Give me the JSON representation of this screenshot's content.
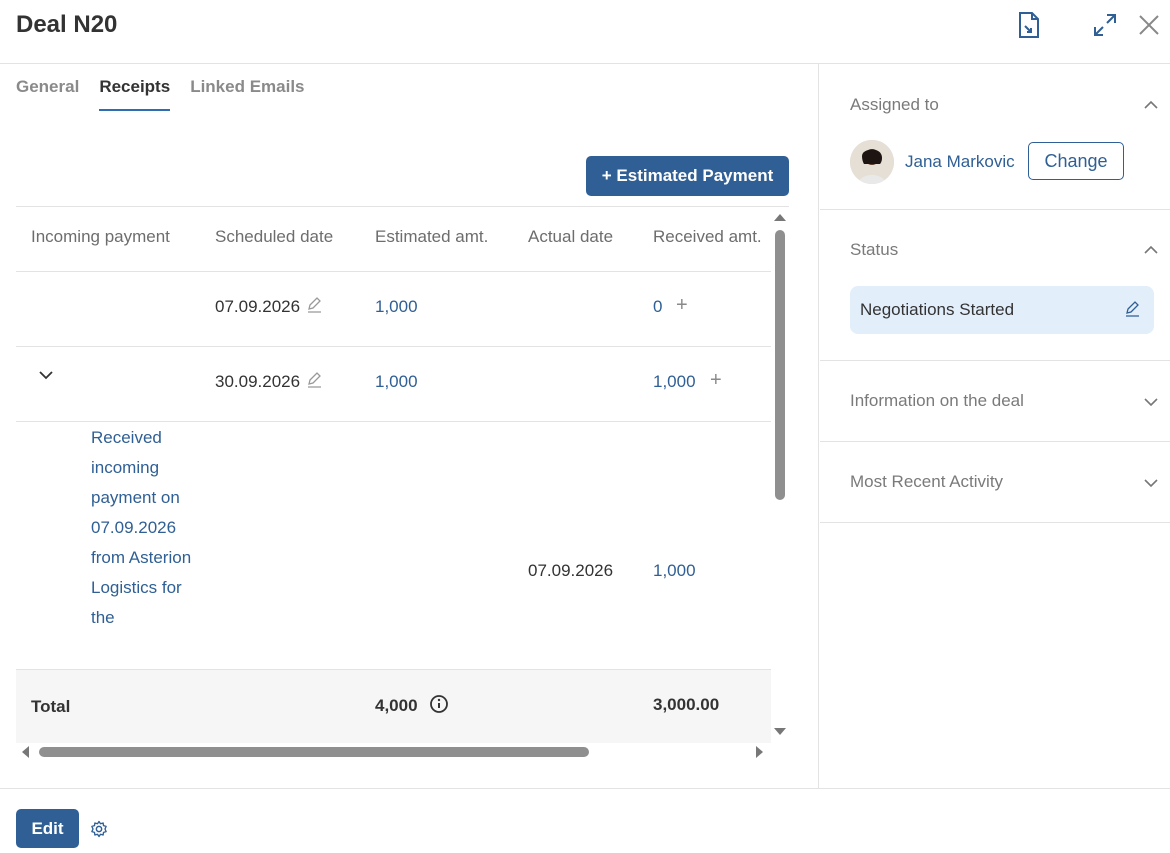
{
  "header": {
    "title": "Deal N20",
    "icons": [
      "document-icon",
      "expand-icon",
      "close-icon"
    ]
  },
  "tabs": [
    {
      "label": "General",
      "active": false
    },
    {
      "label": "Receipts",
      "active": true
    },
    {
      "label": "Linked Emails",
      "active": false
    }
  ],
  "receipts": {
    "add_button": "+ Estimated Payment",
    "columns": [
      "Incoming payment",
      "Scheduled date",
      "Estimated amt.",
      "Actual date",
      "Received amt."
    ],
    "rows": [
      {
        "scheduled_date": "07.09.2026",
        "estimated": "1,000",
        "received": "0"
      },
      {
        "scheduled_date": "30.09.2026",
        "estimated": "1,000",
        "received": "1,000"
      }
    ],
    "sub_row": {
      "description": "Received incoming payment on 07.09.2026 from Asterion Logistics for the",
      "actual_date": "07.09.2026",
      "received": "1,000"
    },
    "total": {
      "label": "Total",
      "estimated": "4,000",
      "received": "3,000.00"
    }
  },
  "sidebar": {
    "assigned": {
      "title": "Assigned to",
      "name": "Jana Markovic",
      "change_label": "Change"
    },
    "status": {
      "title": "Status",
      "value": "Negotiations Started"
    },
    "info": {
      "title": "Information on the deal"
    },
    "activity": {
      "title": "Most Recent Activity"
    }
  },
  "footer": {
    "edit_label": "Edit"
  },
  "colors": {
    "accent": "#2f5f94",
    "status_bg": "#e3eefb"
  }
}
